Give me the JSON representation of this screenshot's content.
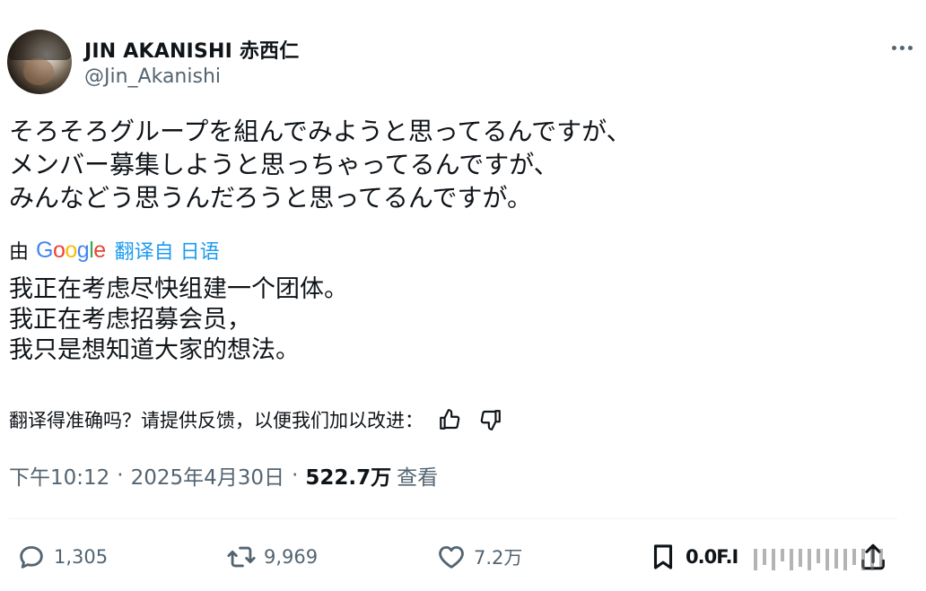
{
  "author": {
    "display_name": "JIN AKANISHI 赤西仁",
    "handle": "@Jin_Akanishi"
  },
  "tweet": {
    "original_lines": [
      "そろそろグループを組んでみようと思ってるんですが、",
      "メンバー募集しようと思っちゃってるんですが、",
      "みんなどう思うんだろうと思ってるんですが。"
    ],
    "translated_by_prefix": "由",
    "translation_provider": "Google",
    "translate_link": "翻译自 日语",
    "translated_lines": [
      "我正在考虑尽快组建一个团体。",
      "我正在考虑招募会员，",
      "我只是想知道大家的想法。"
    ],
    "feedback_prompt": "翻译得准确吗？请提供反馈，以便我们加以改进："
  },
  "meta": {
    "time": "下午10:12",
    "separator": "·",
    "date": "2025年4月30日",
    "views_count": "522.7万",
    "views_label": "查看"
  },
  "actions": {
    "replies": "1,305",
    "reposts": "9,969",
    "likes": "7.2万",
    "bookmarks": "0.0F.I"
  },
  "icons": [
    "more-icon",
    "thumbs-up-icon",
    "thumbs-down-icon",
    "reply-icon",
    "repost-icon",
    "like-icon",
    "bookmark-icon",
    "share-icon"
  ],
  "colors": {
    "text": "#0f1419",
    "secondary": "#536471",
    "link": "#1d9bf0",
    "divider": "#eff3f4"
  }
}
